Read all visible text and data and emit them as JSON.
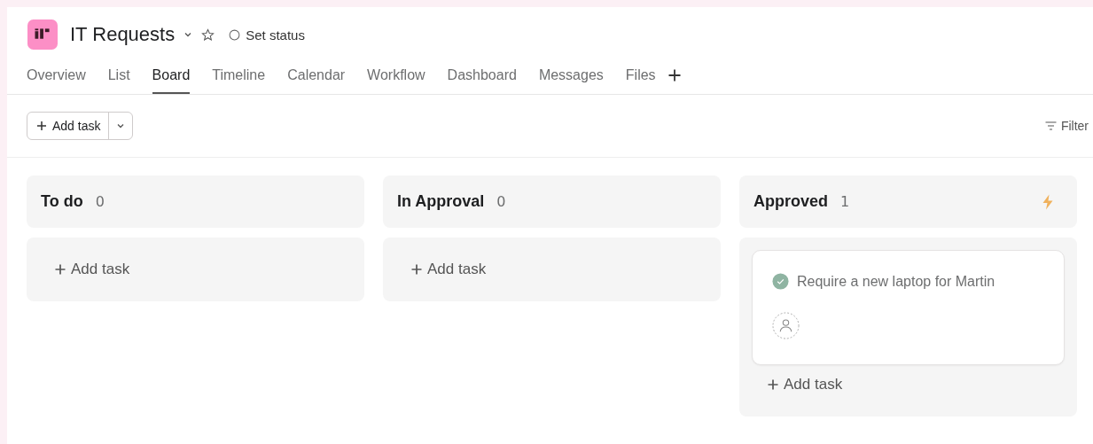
{
  "project": {
    "title": "IT Requests",
    "status_label": "Set status"
  },
  "tabs": [
    {
      "label": "Overview",
      "selected": false
    },
    {
      "label": "List",
      "selected": false
    },
    {
      "label": "Board",
      "selected": true
    },
    {
      "label": "Timeline",
      "selected": false
    },
    {
      "label": "Calendar",
      "selected": false
    },
    {
      "label": "Workflow",
      "selected": false
    },
    {
      "label": "Dashboard",
      "selected": false
    },
    {
      "label": "Messages",
      "selected": false
    },
    {
      "label": "Files",
      "selected": false
    }
  ],
  "toolbar": {
    "add_task": "Add task",
    "filter": "Filter"
  },
  "columns": [
    {
      "title": "To do",
      "count": "0",
      "automation": false,
      "add_label": "Add task"
    },
    {
      "title": "In Approval",
      "count": "0",
      "automation": false,
      "add_label": "Add task"
    },
    {
      "title": "Approved",
      "count": "1",
      "automation": true,
      "tasks": [
        {
          "title": "Require a new laptop for Martin",
          "completed": true
        }
      ],
      "add_label": "Add task"
    }
  ]
}
